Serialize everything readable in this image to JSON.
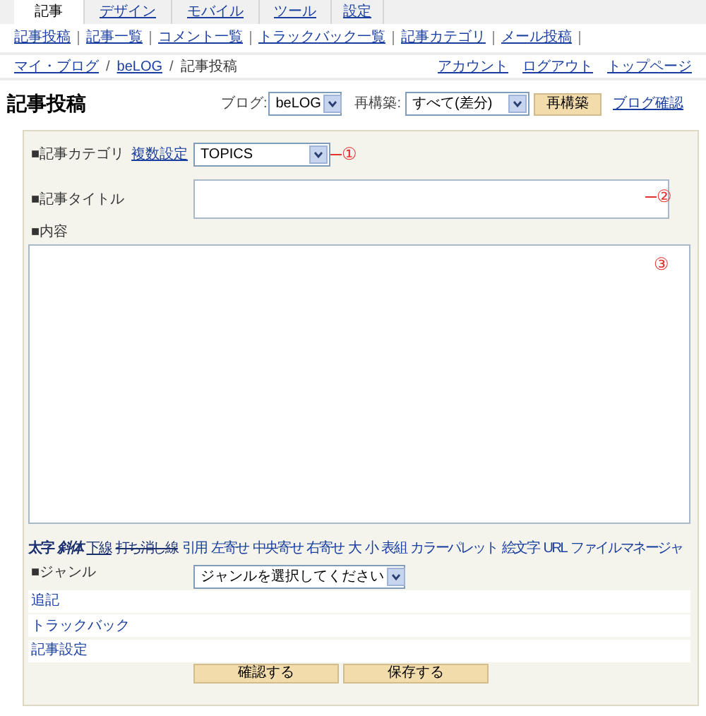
{
  "tabs": [
    {
      "label": "記事",
      "selected": true
    },
    {
      "label": "デザイン",
      "selected": false
    },
    {
      "label": "モバイル",
      "selected": false
    },
    {
      "label": "ツール",
      "selected": false
    },
    {
      "label": "設定",
      "selected": false
    }
  ],
  "sub_menu": [
    "記事投稿",
    "記事一覧",
    "コメント一覧",
    "トラックバック一覧",
    "記事カテゴリ",
    "メール投稿"
  ],
  "breadcrumb": {
    "separator": "/",
    "links": [
      "マイ・ブログ",
      "beLOG"
    ],
    "current": "記事投稿"
  },
  "account_links": [
    "アカウント",
    "ログアウト",
    "トップページ"
  ],
  "page_title": "記事投稿",
  "blog_select": {
    "label": "ブログ:",
    "value": "beLOG"
  },
  "rebuild_select": {
    "label": "再構築:",
    "value": "すべて(差分)"
  },
  "rebuild_button": "再構築",
  "blog_check_link": "ブログ確認",
  "form": {
    "category": {
      "label": "■記事カテゴリ",
      "link": "複数設定",
      "value": "TOPICS",
      "marker": "①"
    },
    "title": {
      "label": "■記事タイトル",
      "marker": "②"
    },
    "content": {
      "label": "■内容",
      "marker": "③"
    },
    "toolbar": [
      {
        "label": "太字",
        "kind": "bold"
      },
      {
        "label": "斜体",
        "kind": "italic"
      },
      {
        "label": "下線",
        "kind": "underline"
      },
      {
        "label": "打ち消し線",
        "kind": "strike"
      },
      {
        "label": "引用",
        "kind": "plain"
      },
      {
        "label": "左寄せ",
        "kind": "plain"
      },
      {
        "label": "中央寄せ",
        "kind": "plain"
      },
      {
        "label": "右寄せ",
        "kind": "plain"
      },
      {
        "label": "大",
        "kind": "plain"
      },
      {
        "label": "小",
        "kind": "plain"
      },
      {
        "label": "表組",
        "kind": "plain"
      },
      {
        "label": "カラーパレット",
        "kind": "plain"
      },
      {
        "label": "絵文字",
        "kind": "plain"
      },
      {
        "label": "URL",
        "kind": "plain"
      },
      {
        "label": "ファイルマネージャ",
        "kind": "plain"
      }
    ],
    "genre": {
      "label": "■ジャンル",
      "value": "ジャンルを選択してください"
    },
    "sections": [
      "追記",
      "トラックバック",
      "記事設定"
    ],
    "buttons": [
      "確認する",
      "保存する"
    ]
  }
}
